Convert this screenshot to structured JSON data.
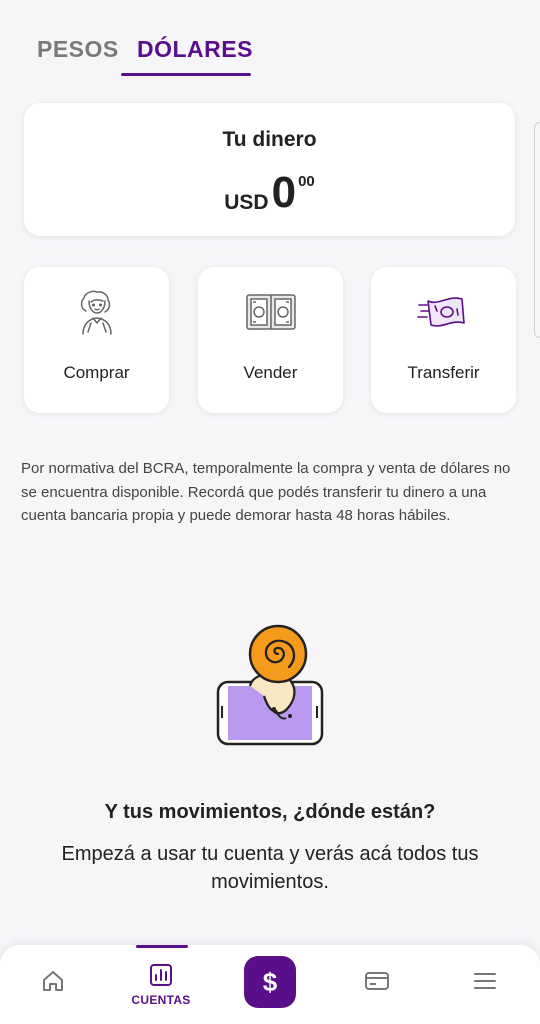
{
  "tabs": [
    {
      "label": "PESOS",
      "active": false
    },
    {
      "label": "DÓLARES",
      "active": true
    }
  ],
  "balance": {
    "title": "Tu dinero",
    "currency": "USD",
    "integer": "0",
    "decimals": "00"
  },
  "actions": [
    {
      "label": "Comprar",
      "icon": "person-money-icon"
    },
    {
      "label": "Vender",
      "icon": "bills-icon"
    },
    {
      "label": "Transferir",
      "icon": "flying-bill-icon"
    }
  ],
  "notice": "Por normativa del BCRA, temporalmente la compra y venta de dólares no se encuentra disponible. Recordá que podés transferir tu dinero a una cuenta bancaria propia y puede demorar hasta 48 horas hábiles.",
  "empty_state": {
    "title": "Y tus movimientos, ¿dónde están?",
    "subtitle": "Empezá a usar tu cuenta y verás acá todos tus movimientos."
  },
  "bottom_nav": {
    "items": [
      {
        "id": "home",
        "icon": "home-icon",
        "label": ""
      },
      {
        "id": "cuentas",
        "icon": "bar-chart-icon",
        "label": "CUENTAS",
        "active": true
      },
      {
        "id": "pay",
        "icon": "dollar-icon",
        "label": "",
        "glyph": "$"
      },
      {
        "id": "card",
        "icon": "card-icon",
        "label": ""
      },
      {
        "id": "menu",
        "icon": "menu-icon",
        "label": ""
      }
    ]
  },
  "colors": {
    "brand_purple": "#5a0f8a",
    "background": "#f6f5f8",
    "card": "#ffffff",
    "snail_orange": "#f59a1b",
    "phone_screen": "#b99af0"
  }
}
